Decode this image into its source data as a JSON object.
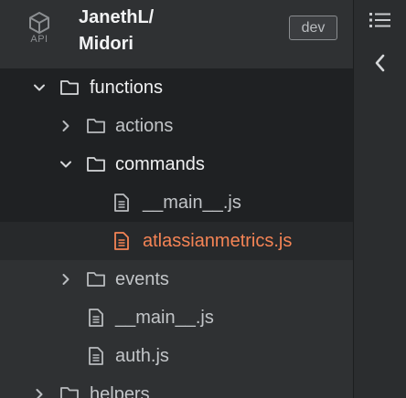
{
  "header": {
    "api_label": "API",
    "project_line1": "JanethL/",
    "project_line2": "Midori",
    "environment": "dev"
  },
  "tree": {
    "items": [
      {
        "label": "functions",
        "type": "folder",
        "expanded": true
      },
      {
        "label": "actions",
        "type": "folder",
        "expanded": false
      },
      {
        "label": "commands",
        "type": "folder",
        "expanded": true
      },
      {
        "label": "__main__.js",
        "type": "file"
      },
      {
        "label": "atlassianmetrics.js",
        "type": "file",
        "selected": true
      },
      {
        "label": "events",
        "type": "folder",
        "expanded": false
      },
      {
        "label": "__main__.js",
        "type": "file"
      },
      {
        "label": "auth.js",
        "type": "file"
      },
      {
        "label": "helpers",
        "type": "folder",
        "expanded": false
      }
    ]
  },
  "rail": {
    "icons": [
      "list-icon",
      "collapse-chevron-icon"
    ]
  },
  "colors": {
    "sidebar_bg": "#2f3133",
    "row_dark_bg": "#1f2123",
    "active_file": "#f58455",
    "text_primary": "#f0f1f2",
    "text_dim": "#c2c5c8"
  }
}
